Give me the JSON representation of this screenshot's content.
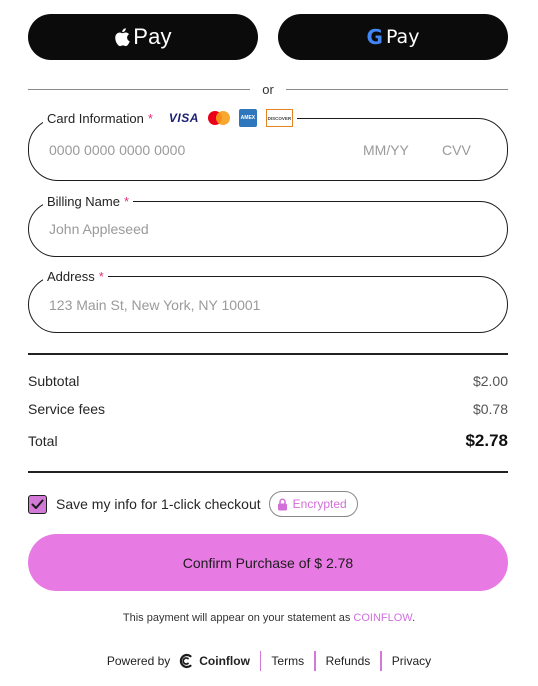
{
  "wallet": {
    "apple_pay_label": "Pay",
    "google_pay_g": "G",
    "google_pay_label": "Pay"
  },
  "divider_or": "or",
  "card": {
    "label": "Card Information",
    "required_mark": "*",
    "brands": [
      "VISA",
      "Mastercard",
      "American Express",
      "Discover"
    ],
    "visa_text": "VISA",
    "amex_text": "AMEX",
    "discover_text": "DISCOVER",
    "number_placeholder": "0000 0000 0000 0000",
    "expiry_placeholder": "MM/YY",
    "cvv_placeholder": "CVV"
  },
  "billing": {
    "label": "Billing Name",
    "required_mark": "*",
    "placeholder": "John Appleseed"
  },
  "address": {
    "label": "Address",
    "required_mark": "*",
    "placeholder": "123 Main St, New York, NY 10001"
  },
  "summary": {
    "subtotal_label": "Subtotal",
    "subtotal_value": "$2.00",
    "fees_label": "Service fees",
    "fees_value": "$0.78",
    "total_label": "Total",
    "total_value": "$2.78"
  },
  "save": {
    "checked": true,
    "label": "Save my info for 1-click checkout",
    "badge_text": "Encrypted"
  },
  "confirm_label": "Confirm Purchase of $ 2.78",
  "statement": {
    "prefix": "This payment will appear on your statement as",
    "brand": "COINFLOW",
    "suffix": "."
  },
  "footer": {
    "powered_by": "Powered by",
    "brand_name": "Coinflow",
    "terms": "Terms",
    "refunds": "Refunds",
    "privacy": "Privacy"
  },
  "colors": {
    "accent": "#e77ae3",
    "accent_text": "#d06fe0",
    "required": "#e0317a",
    "wallet_bg": "#0b0b0b"
  },
  "icons": [
    "apple-icon",
    "google-g-icon",
    "visa-icon",
    "mastercard-icon",
    "amex-icon",
    "discover-icon",
    "checkmark-icon",
    "lock-icon",
    "coinflow-logo-icon"
  ]
}
